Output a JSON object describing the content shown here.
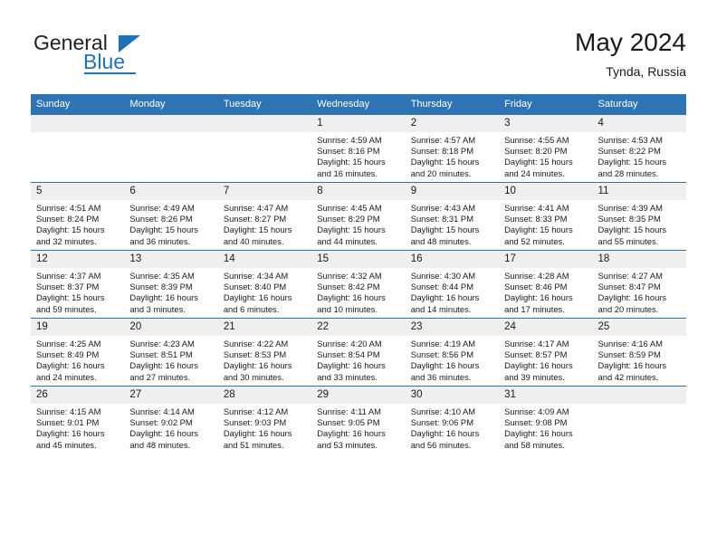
{
  "logo": {
    "line1": "General",
    "line2": "Blue",
    "accent_color": "#1f72b8"
  },
  "header": {
    "title": "May 2024",
    "location": "Tynda, Russia"
  },
  "calendar": {
    "header_bg": "#2e74b5",
    "daynum_bg": "#efefef",
    "weekdays": [
      "Sunday",
      "Monday",
      "Tuesday",
      "Wednesday",
      "Thursday",
      "Friday",
      "Saturday"
    ],
    "weeks": [
      [
        {
          "day": "",
          "empty": true
        },
        {
          "day": "",
          "empty": true
        },
        {
          "day": "",
          "empty": true
        },
        {
          "day": "1",
          "sunrise": "Sunrise: 4:59 AM",
          "sunset": "Sunset: 8:16 PM",
          "daylight": "Daylight: 15 hours and 16 minutes."
        },
        {
          "day": "2",
          "sunrise": "Sunrise: 4:57 AM",
          "sunset": "Sunset: 8:18 PM",
          "daylight": "Daylight: 15 hours and 20 minutes."
        },
        {
          "day": "3",
          "sunrise": "Sunrise: 4:55 AM",
          "sunset": "Sunset: 8:20 PM",
          "daylight": "Daylight: 15 hours and 24 minutes."
        },
        {
          "day": "4",
          "sunrise": "Sunrise: 4:53 AM",
          "sunset": "Sunset: 8:22 PM",
          "daylight": "Daylight: 15 hours and 28 minutes."
        }
      ],
      [
        {
          "day": "5",
          "sunrise": "Sunrise: 4:51 AM",
          "sunset": "Sunset: 8:24 PM",
          "daylight": "Daylight: 15 hours and 32 minutes."
        },
        {
          "day": "6",
          "sunrise": "Sunrise: 4:49 AM",
          "sunset": "Sunset: 8:26 PM",
          "daylight": "Daylight: 15 hours and 36 minutes."
        },
        {
          "day": "7",
          "sunrise": "Sunrise: 4:47 AM",
          "sunset": "Sunset: 8:27 PM",
          "daylight": "Daylight: 15 hours and 40 minutes."
        },
        {
          "day": "8",
          "sunrise": "Sunrise: 4:45 AM",
          "sunset": "Sunset: 8:29 PM",
          "daylight": "Daylight: 15 hours and 44 minutes."
        },
        {
          "day": "9",
          "sunrise": "Sunrise: 4:43 AM",
          "sunset": "Sunset: 8:31 PM",
          "daylight": "Daylight: 15 hours and 48 minutes."
        },
        {
          "day": "10",
          "sunrise": "Sunrise: 4:41 AM",
          "sunset": "Sunset: 8:33 PM",
          "daylight": "Daylight: 15 hours and 52 minutes."
        },
        {
          "day": "11",
          "sunrise": "Sunrise: 4:39 AM",
          "sunset": "Sunset: 8:35 PM",
          "daylight": "Daylight: 15 hours and 55 minutes."
        }
      ],
      [
        {
          "day": "12",
          "sunrise": "Sunrise: 4:37 AM",
          "sunset": "Sunset: 8:37 PM",
          "daylight": "Daylight: 15 hours and 59 minutes."
        },
        {
          "day": "13",
          "sunrise": "Sunrise: 4:35 AM",
          "sunset": "Sunset: 8:39 PM",
          "daylight": "Daylight: 16 hours and 3 minutes."
        },
        {
          "day": "14",
          "sunrise": "Sunrise: 4:34 AM",
          "sunset": "Sunset: 8:40 PM",
          "daylight": "Daylight: 16 hours and 6 minutes."
        },
        {
          "day": "15",
          "sunrise": "Sunrise: 4:32 AM",
          "sunset": "Sunset: 8:42 PM",
          "daylight": "Daylight: 16 hours and 10 minutes."
        },
        {
          "day": "16",
          "sunrise": "Sunrise: 4:30 AM",
          "sunset": "Sunset: 8:44 PM",
          "daylight": "Daylight: 16 hours and 14 minutes."
        },
        {
          "day": "17",
          "sunrise": "Sunrise: 4:28 AM",
          "sunset": "Sunset: 8:46 PM",
          "daylight": "Daylight: 16 hours and 17 minutes."
        },
        {
          "day": "18",
          "sunrise": "Sunrise: 4:27 AM",
          "sunset": "Sunset: 8:47 PM",
          "daylight": "Daylight: 16 hours and 20 minutes."
        }
      ],
      [
        {
          "day": "19",
          "sunrise": "Sunrise: 4:25 AM",
          "sunset": "Sunset: 8:49 PM",
          "daylight": "Daylight: 16 hours and 24 minutes."
        },
        {
          "day": "20",
          "sunrise": "Sunrise: 4:23 AM",
          "sunset": "Sunset: 8:51 PM",
          "daylight": "Daylight: 16 hours and 27 minutes."
        },
        {
          "day": "21",
          "sunrise": "Sunrise: 4:22 AM",
          "sunset": "Sunset: 8:53 PM",
          "daylight": "Daylight: 16 hours and 30 minutes."
        },
        {
          "day": "22",
          "sunrise": "Sunrise: 4:20 AM",
          "sunset": "Sunset: 8:54 PM",
          "daylight": "Daylight: 16 hours and 33 minutes."
        },
        {
          "day": "23",
          "sunrise": "Sunrise: 4:19 AM",
          "sunset": "Sunset: 8:56 PM",
          "daylight": "Daylight: 16 hours and 36 minutes."
        },
        {
          "day": "24",
          "sunrise": "Sunrise: 4:17 AM",
          "sunset": "Sunset: 8:57 PM",
          "daylight": "Daylight: 16 hours and 39 minutes."
        },
        {
          "day": "25",
          "sunrise": "Sunrise: 4:16 AM",
          "sunset": "Sunset: 8:59 PM",
          "daylight": "Daylight: 16 hours and 42 minutes."
        }
      ],
      [
        {
          "day": "26",
          "sunrise": "Sunrise: 4:15 AM",
          "sunset": "Sunset: 9:01 PM",
          "daylight": "Daylight: 16 hours and 45 minutes."
        },
        {
          "day": "27",
          "sunrise": "Sunrise: 4:14 AM",
          "sunset": "Sunset: 9:02 PM",
          "daylight": "Daylight: 16 hours and 48 minutes."
        },
        {
          "day": "28",
          "sunrise": "Sunrise: 4:12 AM",
          "sunset": "Sunset: 9:03 PM",
          "daylight": "Daylight: 16 hours and 51 minutes."
        },
        {
          "day": "29",
          "sunrise": "Sunrise: 4:11 AM",
          "sunset": "Sunset: 9:05 PM",
          "daylight": "Daylight: 16 hours and 53 minutes."
        },
        {
          "day": "30",
          "sunrise": "Sunrise: 4:10 AM",
          "sunset": "Sunset: 9:06 PM",
          "daylight": "Daylight: 16 hours and 56 minutes."
        },
        {
          "day": "31",
          "sunrise": "Sunrise: 4:09 AM",
          "sunset": "Sunset: 9:08 PM",
          "daylight": "Daylight: 16 hours and 58 minutes."
        },
        {
          "day": "",
          "empty": true
        }
      ]
    ]
  }
}
